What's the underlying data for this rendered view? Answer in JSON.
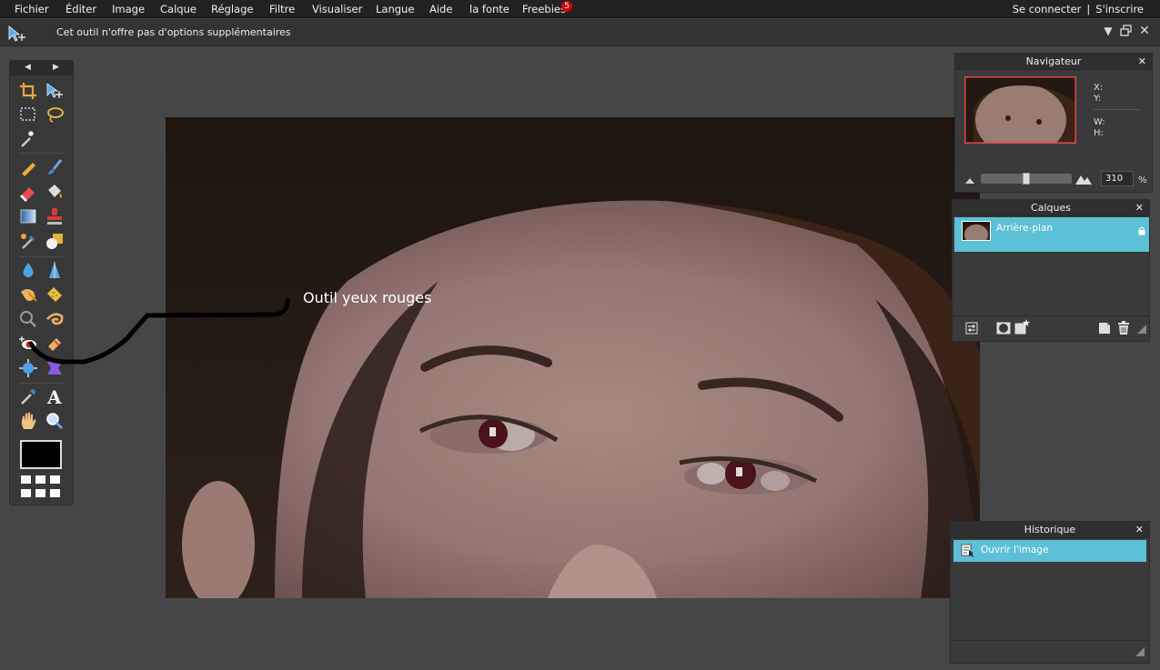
{
  "menubar": {
    "items": [
      "Fichier",
      "Éditer",
      "Image",
      "Calque",
      "Réglage",
      "Filtre",
      "Visualiser",
      "Langue",
      "Aide",
      "la fonte",
      "Freebies"
    ],
    "freebies_badge": "5",
    "login": "Se connecter",
    "separator": "|",
    "signup": "S'inscrire"
  },
  "options_bar": {
    "message": "Cet outil n'offre pas d'options supplémentaires"
  },
  "annotation": {
    "label": "Outil yeux rouges"
  },
  "navigator": {
    "title": "Navigateur",
    "close": "✕",
    "x_label": "X:",
    "y_label": "Y:",
    "w_label": "W:",
    "h_label": "H:",
    "zoom_value": "310",
    "zoom_unit": "%",
    "zoom_slider_fraction": 0.5
  },
  "layers": {
    "title": "Calques",
    "close": "✕",
    "items": [
      {
        "name": "Arrière-plan",
        "locked": true
      }
    ]
  },
  "history": {
    "title": "Historique",
    "close": "✕",
    "items": [
      {
        "label": "Ouvrir l'image"
      }
    ]
  },
  "colors": {
    "menubar": "#222222",
    "workspace": "#464646",
    "selection": "#5cc0d6",
    "foreground": "#000000",
    "badge": "#d50000"
  }
}
